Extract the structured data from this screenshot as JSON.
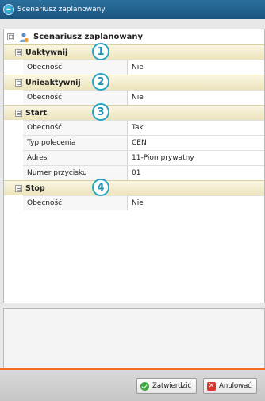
{
  "window": {
    "title": "Scenariusz zaplanowany"
  },
  "tree": {
    "root_label": "Scenariusz zaplanowany",
    "root_toggle": "⊟",
    "categories": [
      {
        "label": "Uaktywnij",
        "toggle": "⊟",
        "callout": "1",
        "properties": [
          {
            "name": "Obecność",
            "value": "Nie"
          }
        ]
      },
      {
        "label": "Unieaktywnij",
        "toggle": "⊟",
        "callout": "2",
        "properties": [
          {
            "name": "Obecność",
            "value": "Nie"
          }
        ]
      },
      {
        "label": "Start",
        "toggle": "⊟",
        "callout": "3",
        "properties": [
          {
            "name": "Obecność",
            "value": "Tak"
          },
          {
            "name": "Typ polecenia",
            "value": "CEN"
          },
          {
            "name": "Adres",
            "value": "11-Pion prywatny"
          },
          {
            "name": "Numer przycisku",
            "value": "01"
          }
        ]
      },
      {
        "label": "Stop",
        "toggle": "⊟",
        "callout": "4",
        "properties": [
          {
            "name": "Obecność",
            "value": "Nie"
          }
        ]
      }
    ]
  },
  "footer": {
    "confirm_label": "Zatwierdzić",
    "cancel_label": "Anulować",
    "cancel_icon_glyph": "✕"
  },
  "colors": {
    "title_bar": "#1a557f",
    "accent_orange": "#f26b22",
    "category_band": "#ece4bb",
    "callout": "#2aa4c4"
  }
}
